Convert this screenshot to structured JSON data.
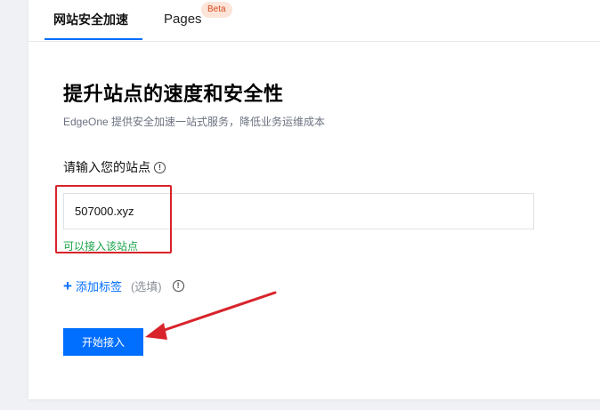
{
  "tabs": [
    {
      "label": "网站安全加速",
      "active": true
    },
    {
      "label": "Pages",
      "badge": "Beta"
    }
  ],
  "main": {
    "heading": "提升站点的速度和安全性",
    "subtitle": "EdgeOne 提供安全加速一站式服务，降低业务运维成本",
    "site_label": "请输入您的站点",
    "site_value": "507000.xyz",
    "valid_message": "可以接入该站点",
    "add_tag_label": "添加标签",
    "optional_label": "(选填)",
    "start_button": "开始接入"
  },
  "colors": {
    "accent": "#006eff",
    "success": "#1aa34a",
    "annotation": "#d8232a"
  },
  "icons": [
    "info-icon",
    "plus-icon"
  ]
}
